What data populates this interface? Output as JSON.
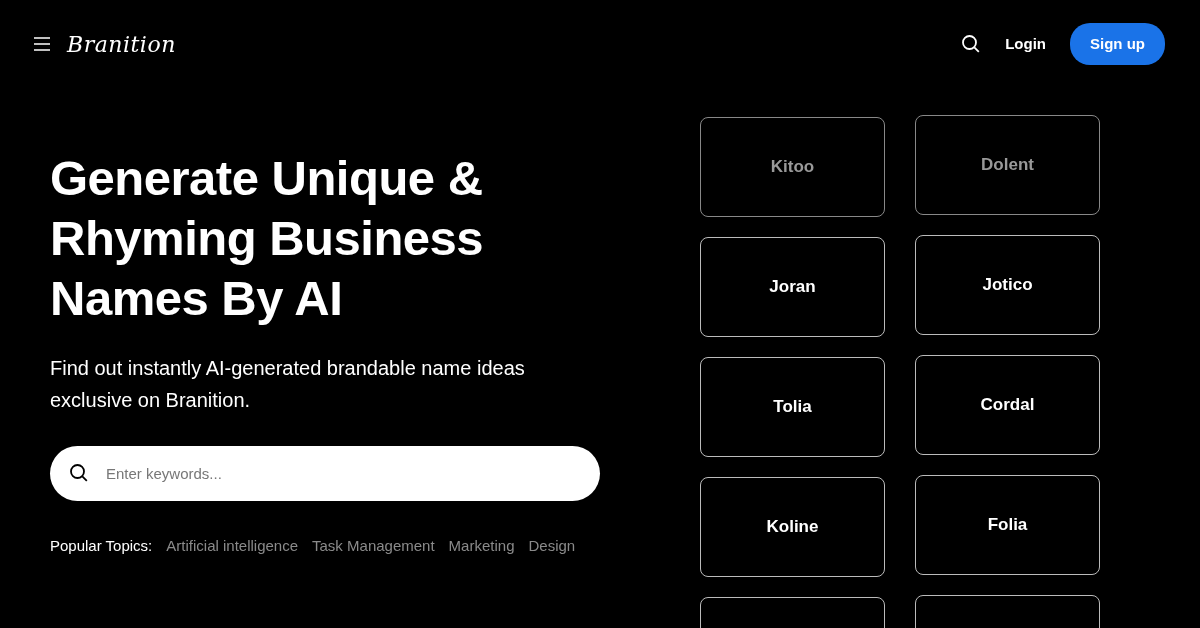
{
  "header": {
    "logo": "Branition",
    "login": "Login",
    "signup": "Sign up"
  },
  "hero": {
    "title": "Generate Unique & Rhyming Business Names By AI",
    "subtitle": "Find out instantly AI-generated brandable name ideas exclusive on Branition.",
    "search": {
      "placeholder": "Enter keywords..."
    },
    "topics_label": "Popular Topics:",
    "topics": [
      "Artificial intelligence",
      "Task Management",
      "Marketing",
      "Design"
    ]
  },
  "name_columns": [
    [
      {
        "kind": "name",
        "name": "Kitoo",
        "faded": true
      },
      {
        "kind": "name",
        "name": "Joran",
        "faded": false
      },
      {
        "kind": "name",
        "name": "Tolia",
        "faded": false
      },
      {
        "kind": "name",
        "name": "Koline",
        "faded": false
      },
      {
        "kind": "partial"
      }
    ],
    [
      {
        "kind": "name",
        "name": "Dolent",
        "faded": true
      },
      {
        "kind": "name",
        "name": "Jotico",
        "faded": false
      },
      {
        "kind": "name",
        "name": "Cordal",
        "faded": false
      },
      {
        "kind": "name",
        "name": "Folia",
        "faded": false
      },
      {
        "kind": "partial"
      }
    ]
  ]
}
